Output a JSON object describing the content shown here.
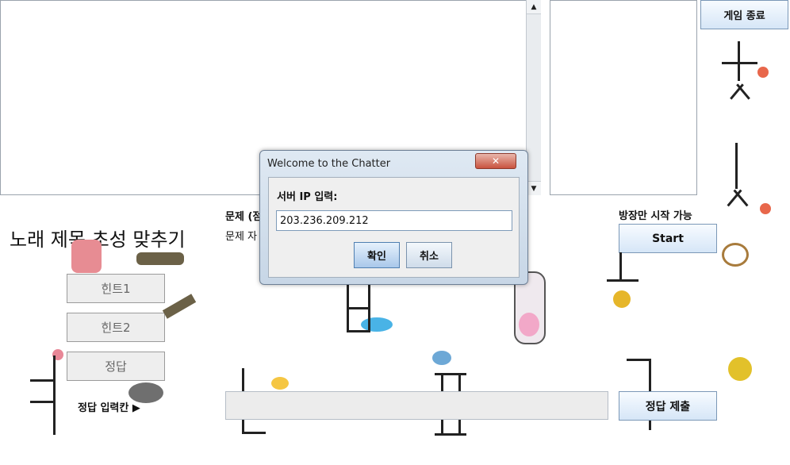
{
  "chat": {
    "scroll_up": "▲",
    "scroll_down": "▼"
  },
  "top_right": {
    "exit_button": "게임 종료"
  },
  "game": {
    "title": "노래 제목 초성 맞추기",
    "problem_label": "문제 (점",
    "problem_text": "문제 자",
    "hint1": "힌트1",
    "hint2": "힌트2",
    "answer": "정답",
    "answer_input_label": "정답 입력칸 ▶",
    "host_start_label": "방장만 시작 가능",
    "start_button": "Start",
    "submit_button": "정답 제출"
  },
  "dialog": {
    "title": "Welcome to the Chatter",
    "close": "✕",
    "prompt": "서버 IP 입력:",
    "ip_value": "203.236.209.212",
    "ok": "확인",
    "cancel": "취소"
  }
}
